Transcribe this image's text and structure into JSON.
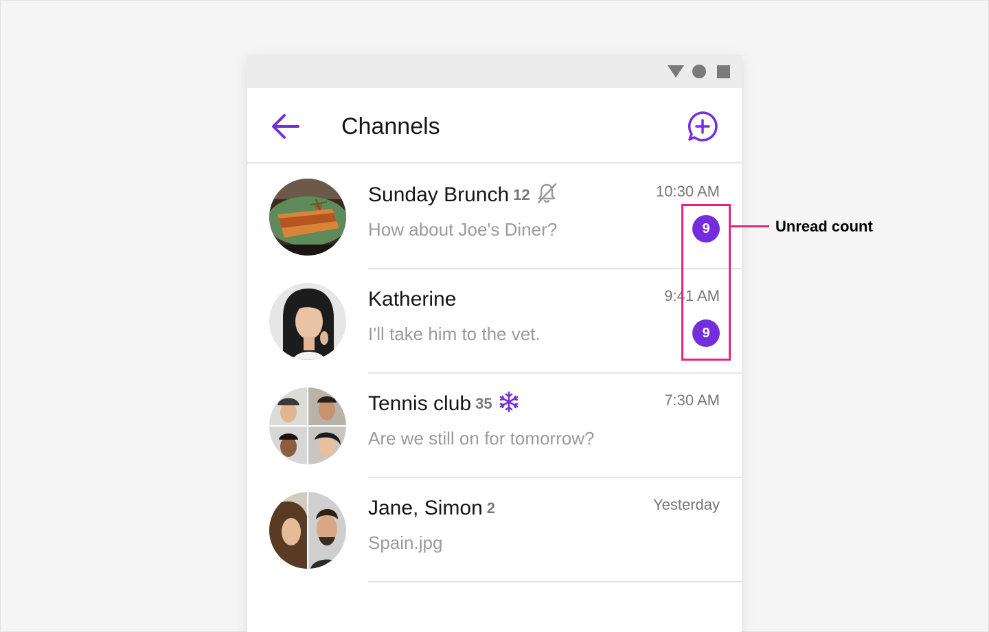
{
  "app": {
    "title": "Channels",
    "accent_color": "#742ddd",
    "back_icon": "arrow-left-icon",
    "new_icon": "chat-bubble-plus-icon"
  },
  "status_bar": {
    "icons": [
      "signal-triangle-icon",
      "battery-dot-icon",
      "recent-square-icon"
    ]
  },
  "channels": [
    {
      "name": "Sunday Brunch",
      "member_count": "12",
      "status_icon": "bell-muted-icon",
      "preview": "How about Joe's Diner?",
      "time": "10:30 AM",
      "unread": "9"
    },
    {
      "name": "Katherine",
      "member_count": "",
      "status_icon": "",
      "preview": "I'll take him to the vet.",
      "time": "9:41 AM",
      "unread": "9"
    },
    {
      "name": "Tennis club",
      "member_count": "35",
      "status_icon": "snowflake-frozen-icon",
      "preview": "Are we still on for tomorrow?",
      "time": "7:30 AM",
      "unread": ""
    },
    {
      "name": "Jane, Simon",
      "member_count": "2",
      "status_icon": "",
      "preview": "Spain.jpg",
      "time": "Yesterday",
      "unread": ""
    }
  ],
  "annotation": {
    "label": "Unread count",
    "color": "#e8247a"
  }
}
